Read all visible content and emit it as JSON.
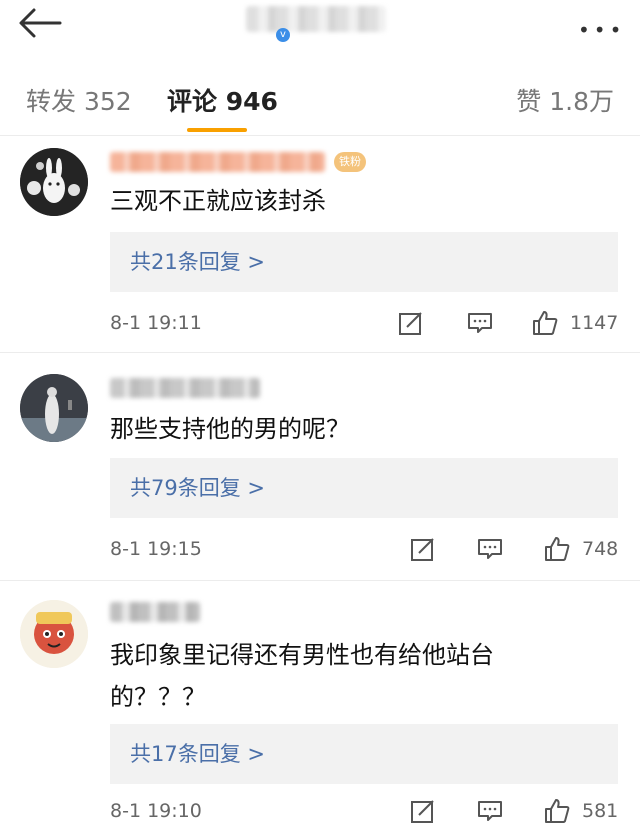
{
  "header": {
    "back_icon": "arrow-left-icon",
    "more_icon": "more-dots-icon",
    "more_glyph": "•••",
    "verified_glyph": "v"
  },
  "tabs": [
    {
      "label": "转发 352"
    },
    {
      "label": "评论 946"
    },
    {
      "label": "赞 1.8万"
    }
  ],
  "colors": {
    "tab_indicator": "#f9a000",
    "reply_link": "#4a6fa8",
    "reply_bg": "#f2f2f2"
  },
  "comments": [
    {
      "fan_badge": "铁粉",
      "text": "三观不正就应该封杀",
      "reply_summary": "共21条回复 >",
      "time": "8-1 19:11",
      "like_count": "1147"
    },
    {
      "text": "那些支持他的男的呢？",
      "reply_summary": "共79条回复 >",
      "time": "8-1 19:15",
      "like_count": "748"
    },
    {
      "text_line1": "我印象里记得还有男性也有给他站台",
      "text_line2": "的？？？",
      "reply_summary": "共17条回复 >",
      "time": "8-1 19:10",
      "like_count": "581"
    }
  ]
}
